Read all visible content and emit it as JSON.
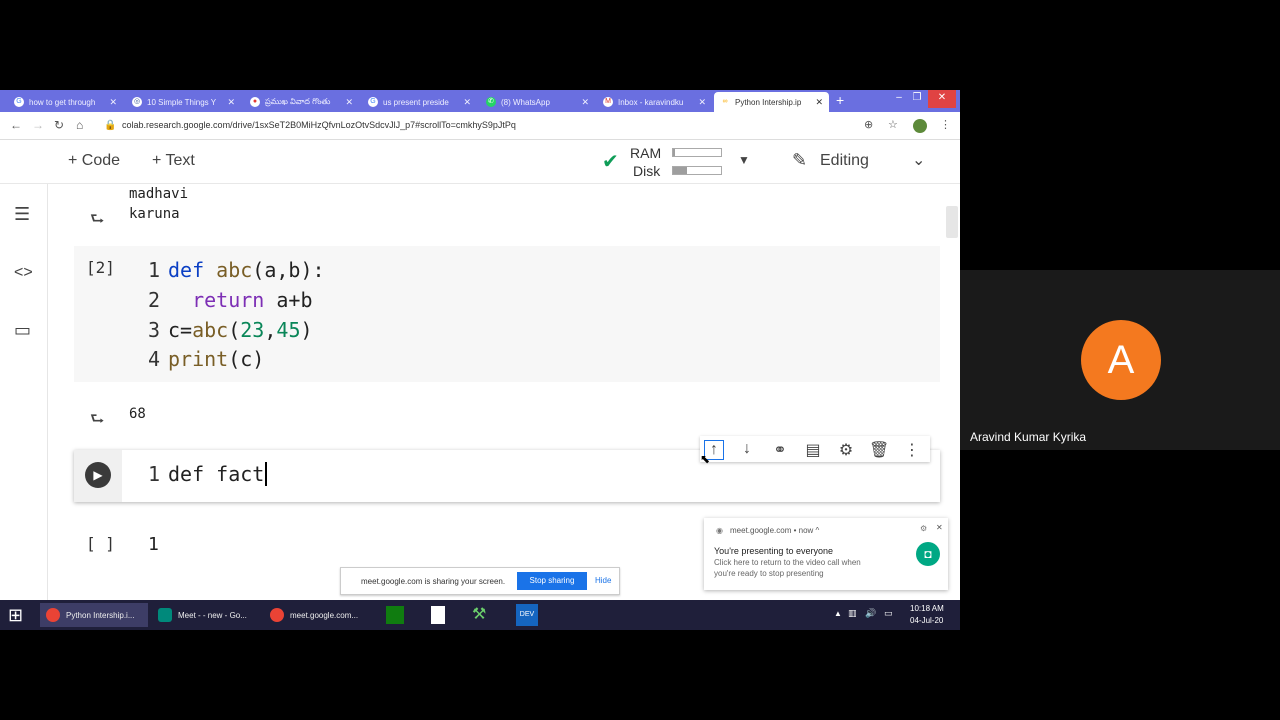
{
  "browser": {
    "tabs": [
      {
        "label": "how to get through",
        "icon": "google-icon",
        "color": "#4285f4"
      },
      {
        "label": "10 Simple Things Y",
        "icon": "chat-icon",
        "color": "#3b5998"
      },
      {
        "label": "ప్రముఖ వివాద గొంతు",
        "icon": "news-icon",
        "color": "#e53935"
      },
      {
        "label": "us present preside",
        "icon": "google-icon",
        "color": "#4285f4"
      },
      {
        "label": "(8) WhatsApp",
        "icon": "whatsapp-icon",
        "color": "#25d366"
      },
      {
        "label": "Inbox - karavindku",
        "icon": "gmail-icon",
        "color": "#d93025"
      },
      {
        "label": "Python Intership.ip",
        "icon": "colab-icon",
        "color": "#f9ab00"
      }
    ],
    "url": "colab.research.google.com/drive/1sxSeT2B0MiHzQfvnLozOtvSdcvJlJ_p7#scrollTo=cmkhyS9pJtPq"
  },
  "colab": {
    "toolbar": {
      "code_label": "Code",
      "text_label": "Text",
      "ram_label": "RAM",
      "disk_label": "Disk",
      "ram_fraction": 0.05,
      "disk_fraction": 0.3,
      "editing_label": "Editing"
    },
    "output1": [
      "madhavi",
      "karuna"
    ],
    "cell2": {
      "count": "[2]",
      "lines": [
        {
          "n": "1",
          "code": "def abc(a,b):"
        },
        {
          "n": "2",
          "code": "  return a+b"
        },
        {
          "n": "3",
          "code": "c=abc(23,45)"
        },
        {
          "n": "4",
          "code": "print(c)"
        }
      ],
      "output": "68"
    },
    "cell3": {
      "line_no": "1",
      "code": "def fact"
    },
    "cell4": {
      "count": "[ ]",
      "line_no": "1"
    }
  },
  "share_bar": {
    "message": "meet.google.com is sharing your screen.",
    "stop_label": "Stop sharing",
    "hide_label": "Hide"
  },
  "notification": {
    "source": "meet.google.com • now ^",
    "title": "You're presenting to everyone",
    "body1": "Click here to return to the video call when",
    "body2": "you're ready to stop presenting"
  },
  "taskbar": {
    "apps": [
      {
        "label": "Python Intership.i...",
        "color": "#ea4335"
      },
      {
        "label": "Meet - - new - Go...",
        "color": "#00897b"
      },
      {
        "label": "meet.google.com...",
        "color": "#ea4335"
      }
    ],
    "time": "10:18 AM",
    "date": "04-Jul-20"
  },
  "participant": {
    "initial": "A",
    "name": "Aravind Kumar Kyrika",
    "avatar_color": "#f4791f"
  }
}
